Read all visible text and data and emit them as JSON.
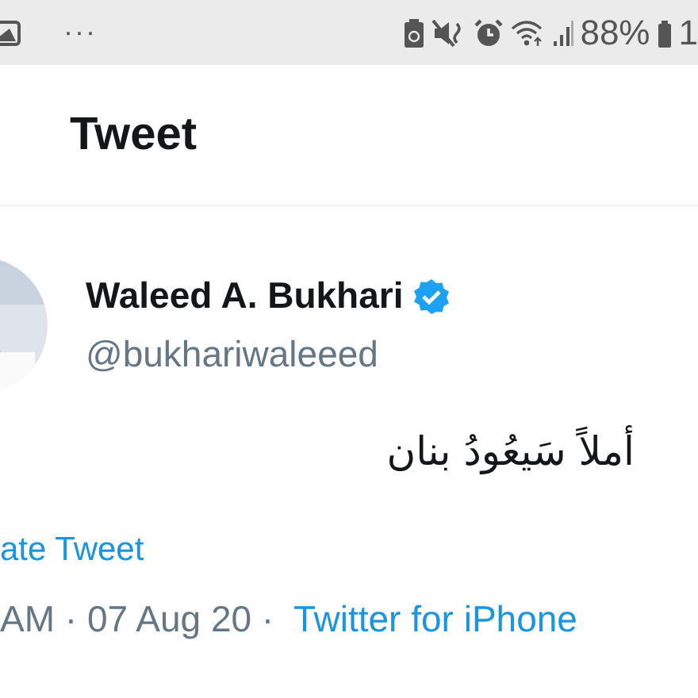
{
  "status_bar": {
    "more": "···",
    "battery_percent": "88%",
    "clock": "1"
  },
  "header": {
    "title": "Tweet"
  },
  "tweet": {
    "name": "Waleed A. Bukhari",
    "verified": true,
    "handle": "@bukhariwaleeed",
    "text": "أملاً سَيعُودُ بنان",
    "translate": "ate Tweet",
    "meta": "AM · 07 Aug 20 · ",
    "source": "Twitter for iPhone"
  }
}
